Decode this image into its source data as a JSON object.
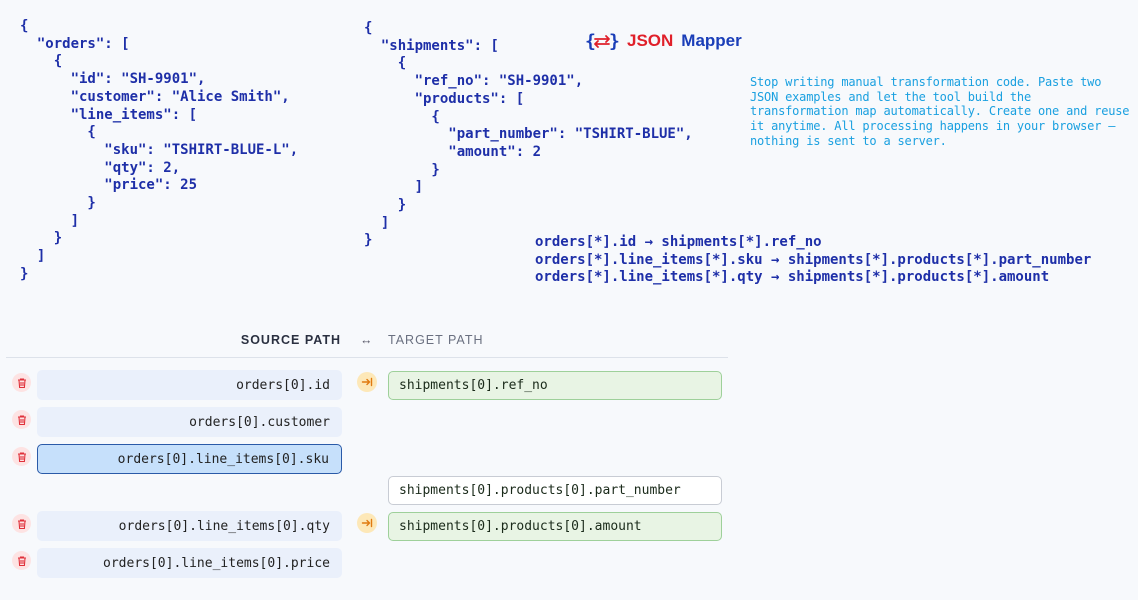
{
  "app": {
    "logo_word1": "JSON",
    "logo_word2": "Mapper",
    "tagline": "Stop writing manual transformation code. Paste two JSON examples and let the tool build the transformation map automatically. Create one and reuse it anytime. All processing happens in your browser — nothing is sent to a server."
  },
  "source_json": "{\n  \"orders\": [\n    {\n      \"id\": \"SH-9901\",\n      \"customer\": \"Alice Smith\",\n      \"line_items\": [\n        {\n          \"sku\": \"TSHIRT-BLUE-L\",\n          \"qty\": 2,\n          \"price\": 25\n        }\n      ]\n    }\n  ]\n}",
  "target_json": "{\n  \"shipments\": [\n    {\n      \"ref_no\": \"SH-9901\",\n      \"products\": [\n        {\n          \"part_number\": \"TSHIRT-BLUE\",\n          \"amount\": 2\n        }\n      ]\n    }\n  ]\n}",
  "rules": [
    "orders[*].id → shipments[*].ref_no",
    "orders[*].line_items[*].sku → shipments[*].products[*].part_number",
    "orders[*].line_items[*].qty → shipments[*].products[*].amount"
  ],
  "table": {
    "header_source": "SOURCE PATH",
    "header_arrow": "↔",
    "header_target": "TARGET PATH",
    "source_rows": [
      "orders[0].id",
      "orders[0].customer",
      "orders[0].line_items[0].sku",
      "orders[0].line_items[0].qty",
      "orders[0].line_items[0].price"
    ],
    "target_rows": [
      "shipments[0].ref_no",
      "shipments[0].products[0].part_number",
      "shipments[0].products[0].amount"
    ]
  },
  "colors": {
    "code": "#1e2fa8",
    "tagline": "#1aa0e0",
    "logo_json": "#e0202a",
    "logo_mapper": "#1a3eb8",
    "delete": "#e0303a",
    "link": "#e07a10"
  }
}
